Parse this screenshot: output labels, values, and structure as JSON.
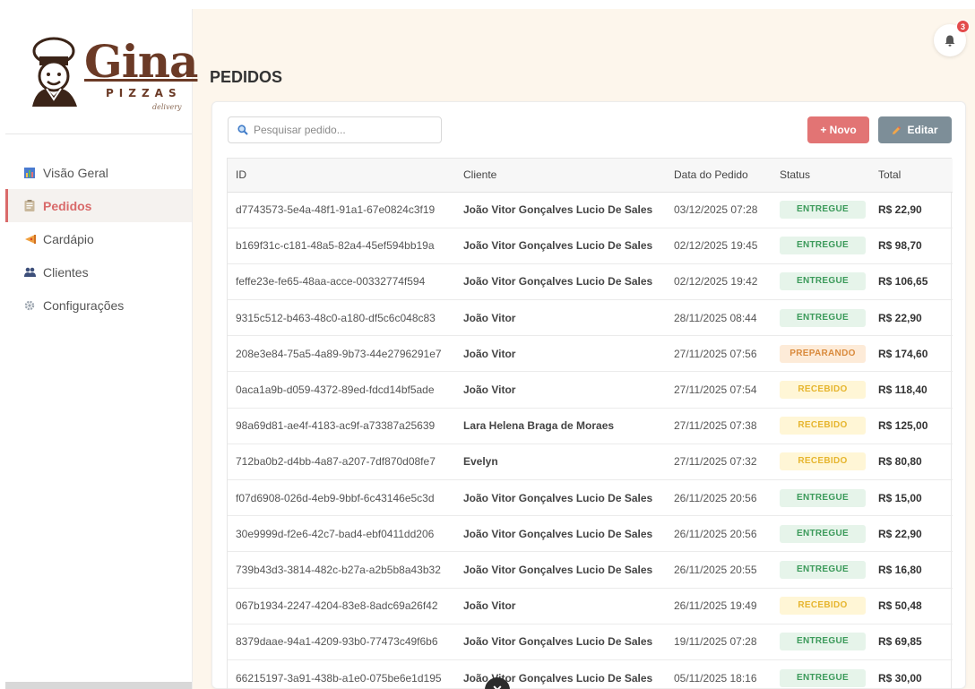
{
  "brand": {
    "name": "Gina",
    "sub": "PIZZAS",
    "tag": "delivery"
  },
  "sidebar": {
    "items": [
      {
        "label": "Visão Geral",
        "icon": "chart-icon",
        "active": false
      },
      {
        "label": "Pedidos",
        "icon": "clipboard-icon",
        "active": true
      },
      {
        "label": "Cardápio",
        "icon": "pizza-slice-icon",
        "active": false
      },
      {
        "label": "Clientes",
        "icon": "users-icon",
        "active": false
      },
      {
        "label": "Configurações",
        "icon": "gear-icon",
        "active": false
      }
    ]
  },
  "header": {
    "title": "PEDIDOS",
    "notifications": "3"
  },
  "toolbar": {
    "search_placeholder": "Pesquisar pedido...",
    "new_label": "+ Novo",
    "edit_label": "Editar"
  },
  "table": {
    "columns": [
      "ID",
      "Cliente",
      "Data do Pedido",
      "Status",
      "Total"
    ],
    "rows": [
      {
        "id": "d7743573-5e4a-48f1-91a1-67e0824c3f19",
        "client": "João Vitor Gonçalves Lucio De Sales",
        "date": "03/12/2025 07:28",
        "status": "ENTREGUE",
        "total": "R$ 22,90"
      },
      {
        "id": "b169f31c-c181-48a5-82a4-45ef594bb19a",
        "client": "João Vitor Gonçalves Lucio De Sales",
        "date": "02/12/2025 19:45",
        "status": "ENTREGUE",
        "total": "R$ 98,70"
      },
      {
        "id": "feffe23e-fe65-48aa-acce-00332774f594",
        "client": "João Vitor Gonçalves Lucio De Sales",
        "date": "02/12/2025 19:42",
        "status": "ENTREGUE",
        "total": "R$ 106,65"
      },
      {
        "id": "9315c512-b463-48c0-a180-df5c6c048c83",
        "client": "João Vitor",
        "date": "28/11/2025 08:44",
        "status": "ENTREGUE",
        "total": "R$ 22,90"
      },
      {
        "id": "208e3e84-75a5-4a89-9b73-44e2796291e7",
        "client": "João Vitor",
        "date": "27/11/2025 07:56",
        "status": "PREPARANDO",
        "total": "R$ 174,60"
      },
      {
        "id": "0aca1a9b-d059-4372-89ed-fdcd14bf5ade",
        "client": "João Vitor",
        "date": "27/11/2025 07:54",
        "status": "RECEBIDO",
        "total": "R$ 118,40"
      },
      {
        "id": "98a69d81-ae4f-4183-ac9f-a73387a25639",
        "client": "Lara Helena Braga de Moraes",
        "date": "27/11/2025 07:38",
        "status": "RECEBIDO",
        "total": "R$ 125,00"
      },
      {
        "id": "712ba0b2-d4bb-4a87-a207-7df870d08fe7",
        "client": "Evelyn",
        "date": "27/11/2025 07:32",
        "status": "RECEBIDO",
        "total": "R$ 80,80"
      },
      {
        "id": "f07d6908-026d-4eb9-9bbf-6c43146e5c3d",
        "client": "João Vitor Gonçalves Lucio De Sales",
        "date": "26/11/2025 20:56",
        "status": "ENTREGUE",
        "total": "R$ 15,00"
      },
      {
        "id": "30e9999d-f2e6-42c7-bad4-ebf0411dd206",
        "client": "João Vitor Gonçalves Lucio De Sales",
        "date": "26/11/2025 20:56",
        "status": "ENTREGUE",
        "total": "R$ 22,90"
      },
      {
        "id": "739b43d3-3814-482c-b27a-a2b5b8a43b32",
        "client": "João Vitor Gonçalves Lucio De Sales",
        "date": "26/11/2025 20:55",
        "status": "ENTREGUE",
        "total": "R$ 16,80"
      },
      {
        "id": "067b1934-2247-4204-83e8-8adc69a26f42",
        "client": "João Vitor",
        "date": "26/11/2025 19:49",
        "status": "RECEBIDO",
        "total": "R$ 50,48"
      },
      {
        "id": "8379daae-94a1-4209-93b0-77473c49f6b6",
        "client": "João Vitor Gonçalves Lucio De Sales",
        "date": "19/11/2025 07:28",
        "status": "ENTREGUE",
        "total": "R$ 69,85"
      },
      {
        "id": "66215197-3a91-438b-a1e0-075be6e1d195",
        "client": "João Vitor Gonçalves Lucio De Sales",
        "date": "05/11/2025 18:16",
        "status": "ENTREGUE",
        "total": "R$ 30,00"
      }
    ]
  },
  "colors": {
    "accent": "#e27474",
    "edit": "#7d8e98",
    "background": "#fdf6ec",
    "brand": "#6b3a26"
  }
}
